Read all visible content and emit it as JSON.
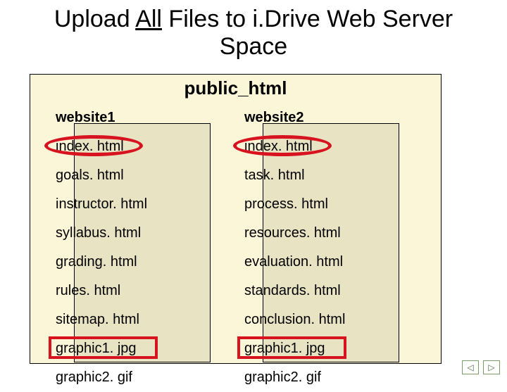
{
  "title": {
    "pre": "Upload ",
    "underlined": "All",
    "post": " Files to i.Drive Web Server Space"
  },
  "outer_label": "public_html",
  "columns": [
    {
      "header": "website1",
      "files": [
        "index. html",
        "goals. html",
        "instructor. html",
        "syllabus. html",
        "grading. html",
        "rules. html",
        "sitemap. html",
        "graphic1. jpg",
        "graphic2. gif"
      ],
      "circle_index": 0,
      "rect_index": 7
    },
    {
      "header": "website2",
      "files": [
        "index. html",
        "task. html",
        "process. html",
        "resources. html",
        "evaluation. html",
        "standards. html",
        "conclusion. html",
        "graphic1. jpg",
        "graphic2. gif"
      ],
      "circle_index": 0,
      "rect_index": 7
    }
  ],
  "nav": {
    "prev": "◁",
    "next": "▷"
  },
  "colors": {
    "highlight": "#d6131e",
    "outer_bg": "#fcf6d8",
    "inner_bg": "#e8e4c3"
  }
}
